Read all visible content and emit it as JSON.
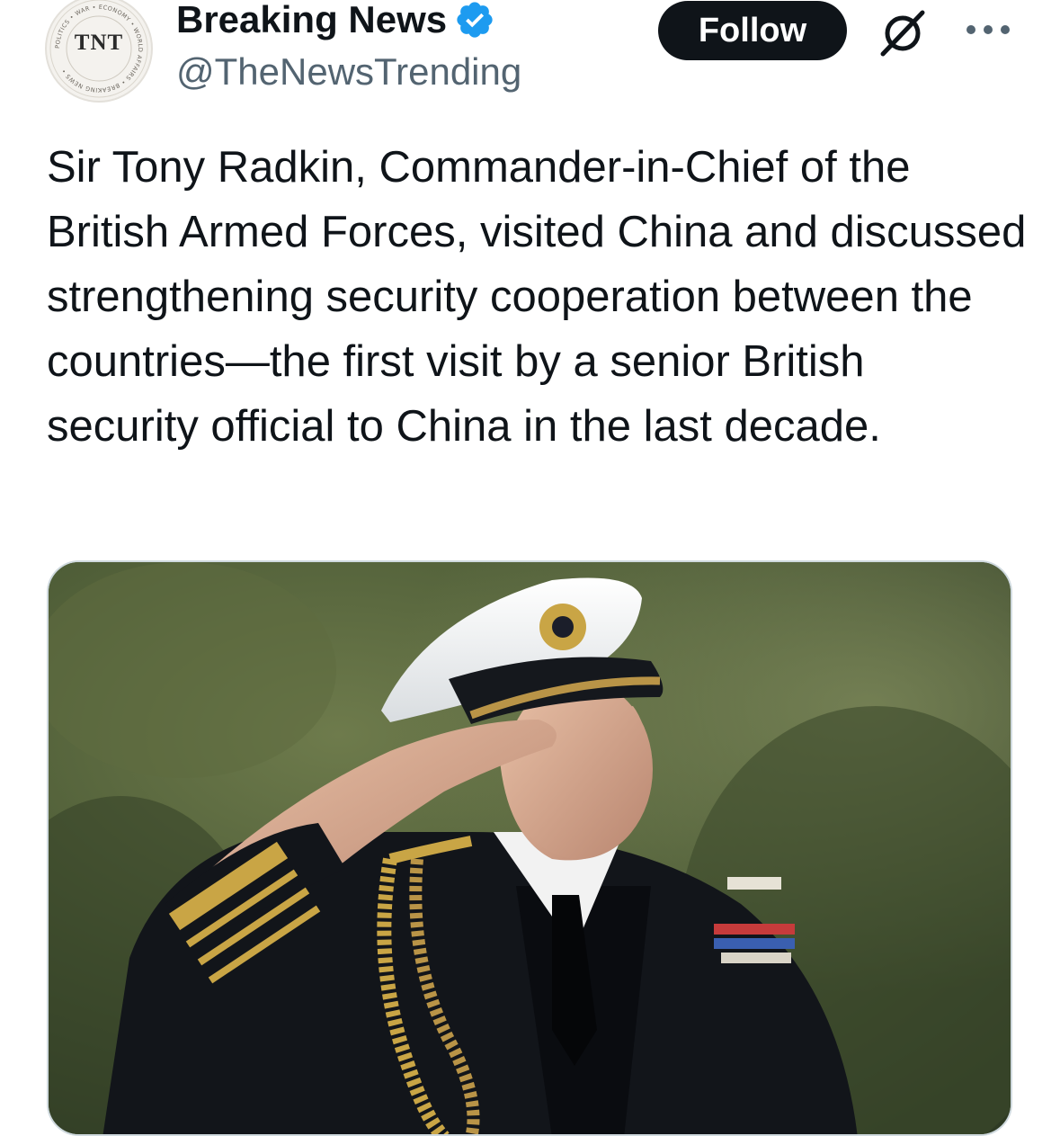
{
  "header": {
    "avatar": {
      "text": "TNT",
      "ring_text": "POLITICS • WAR • ECONOMY • WORLD AFFAIRS • BREAKING NEWS •"
    },
    "display_name": "Breaking News",
    "verified_icon": "verified-badge-icon",
    "handle": "@TheNewsTrending",
    "follow_label": "Follow",
    "grok_icon": "grok-icon",
    "more_icon": "more-options-icon"
  },
  "tweet": {
    "text": "Sir Tony Radkin, Commander-in-Chief of the British Armed Forces, visited China and discussed strengthening security cooperation between the countries—the first visit by a senior British security official to China in the last decade."
  },
  "media": {
    "photo_icon": "photo-naval-officer-saluting"
  },
  "colors": {
    "text_primary": "#0f1419",
    "text_secondary": "#536471",
    "verified_blue": "#1d9bf0",
    "follow_bg": "#0f1419",
    "follow_text": "#ffffff",
    "media_border": "#cfd9de"
  }
}
